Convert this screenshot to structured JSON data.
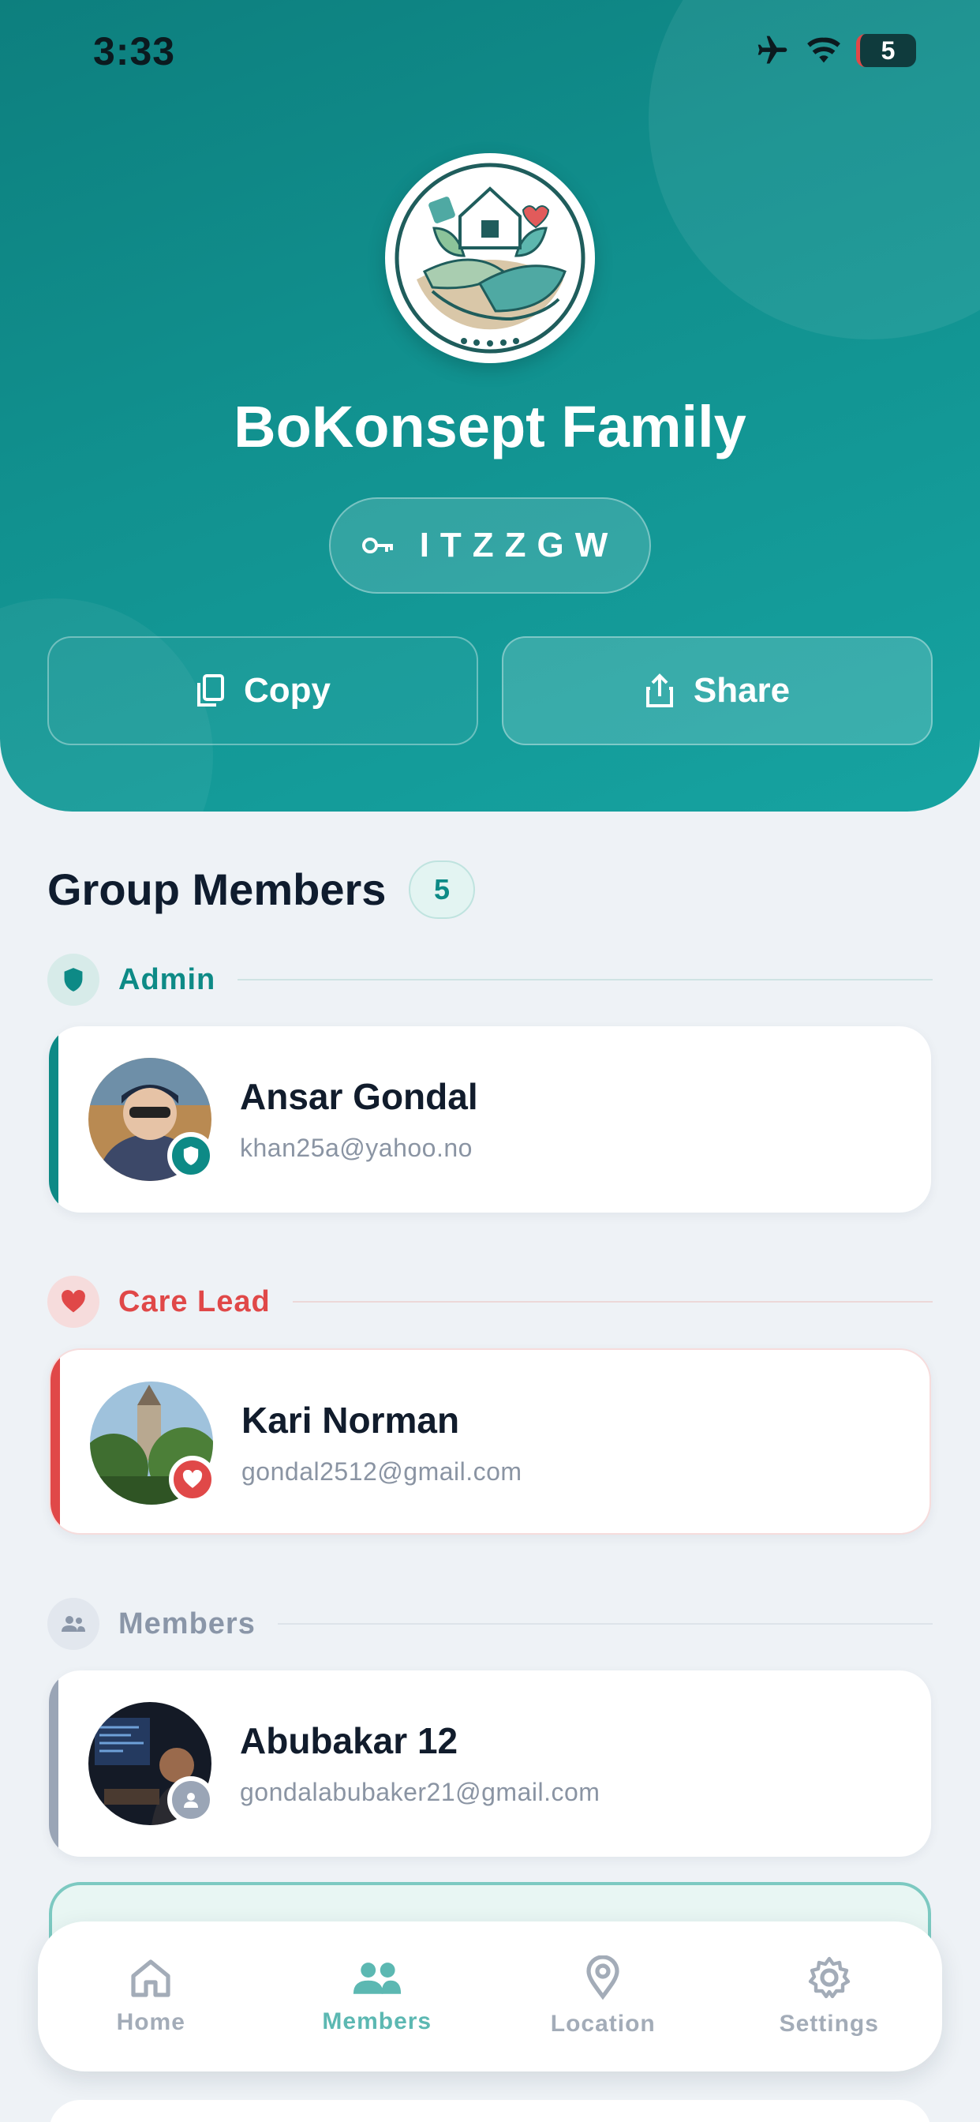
{
  "status_bar": {
    "time": "3:33",
    "battery": "5"
  },
  "group": {
    "name": "BoKonsept Family",
    "code": "ITZZGW"
  },
  "actions": {
    "copy_label": "Copy",
    "share_label": "Share"
  },
  "members_section": {
    "title": "Group Members",
    "count": "5",
    "roles": {
      "admin": {
        "label": "Admin",
        "color": "#0d8a86"
      },
      "care_lead": {
        "label": "Care Lead",
        "color": "#e04848"
      },
      "members": {
        "label": "Members",
        "color": "#8a96a8"
      }
    },
    "list": [
      {
        "name": "Ansar Gondal",
        "email": "khan25a@yahoo.no",
        "role": "admin"
      },
      {
        "name": "Kari Norman",
        "email": "gondal2512@gmail.com",
        "role": "care_lead"
      },
      {
        "name": "Abubakar 12",
        "email": "gondalabubaker21@gmail.com",
        "role": "members"
      }
    ]
  },
  "tabs": [
    {
      "label": "Home",
      "icon": "home-icon",
      "active": false
    },
    {
      "label": "Members",
      "icon": "members-icon",
      "active": true
    },
    {
      "label": "Location",
      "icon": "location-pin-icon",
      "active": false
    },
    {
      "label": "Settings",
      "icon": "gear-icon",
      "active": false
    }
  ]
}
